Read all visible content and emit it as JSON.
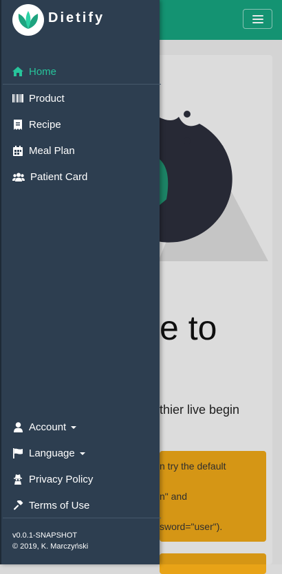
{
  "app": {
    "name": "Dietify"
  },
  "colors": {
    "accent": "#27c49b",
    "sidebar": "#2d3e50",
    "topbar": "#16a07c",
    "alert": "#e8a317"
  },
  "sidebar": {
    "items": [
      {
        "label": "Home",
        "icon": "home-icon",
        "active": true
      },
      {
        "label": "Product",
        "icon": "barcode-icon"
      },
      {
        "label": "Recipe",
        "icon": "receipt-icon"
      },
      {
        "label": "Meal Plan",
        "icon": "calendar-icon"
      },
      {
        "label": "Patient Card",
        "icon": "users-icon"
      }
    ],
    "bottom_items": [
      {
        "label": "Account",
        "icon": "user-icon"
      },
      {
        "label": "Language",
        "icon": "flag-icon"
      },
      {
        "label": "Privacy Policy",
        "icon": "spy-icon"
      },
      {
        "label": "Terms of Use",
        "icon": "gavel-icon"
      }
    ],
    "version": "v0.0.1-SNAPSHOT",
    "copyright": "© 2019, K. Marczyński"
  },
  "main": {
    "welcome_fragment": "e to",
    "tagline_fragment": "thier live begin",
    "alert_lines": [
      "n try the default",
      "n\" and",
      "sword=\"user\")."
    ]
  }
}
